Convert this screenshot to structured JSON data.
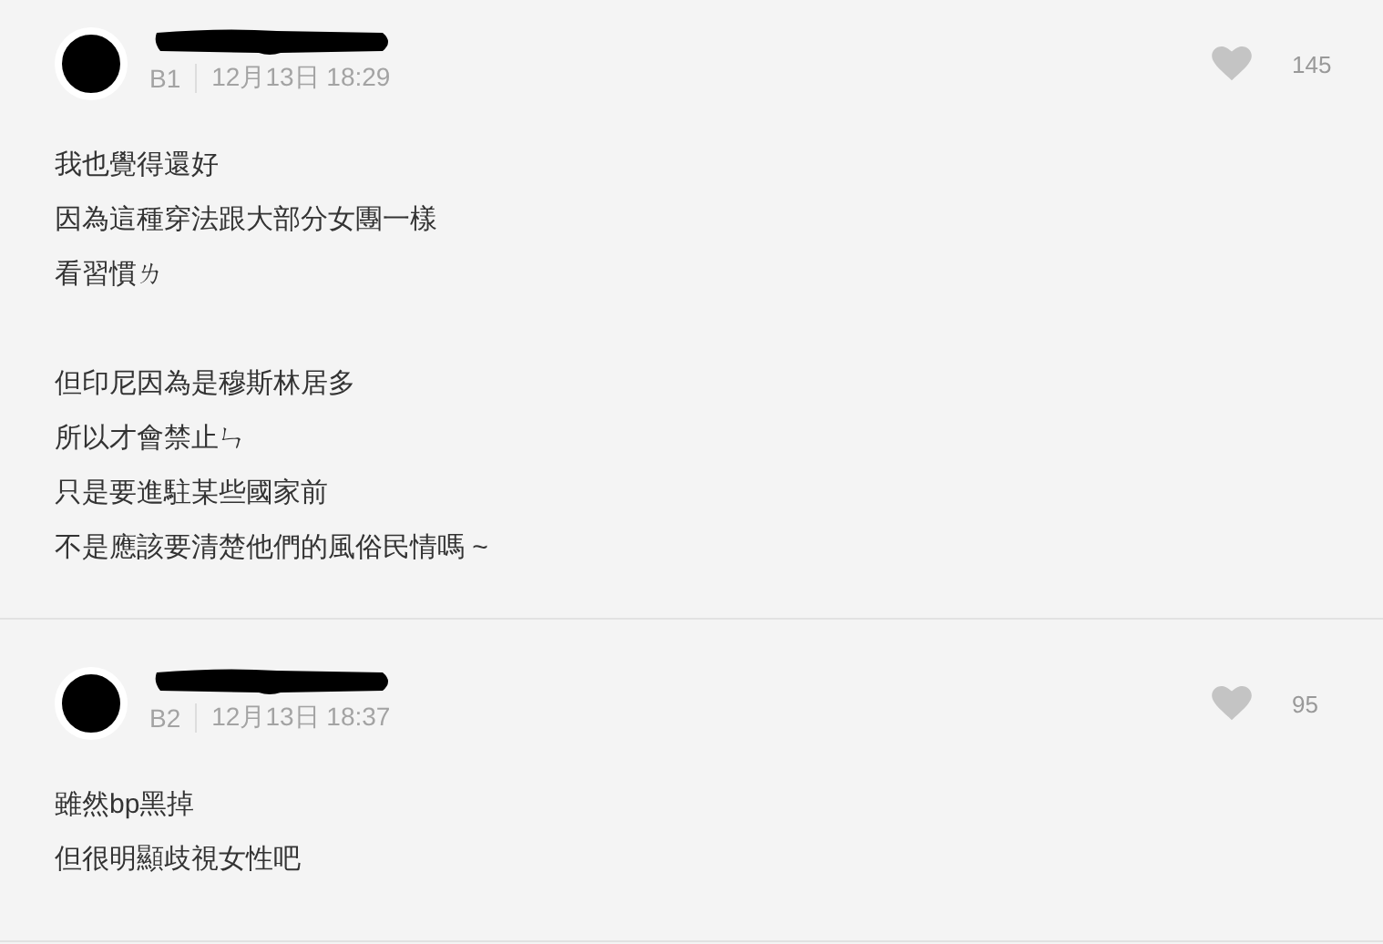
{
  "comments": [
    {
      "floor": "B1",
      "time": "12月13日 18:29",
      "likes": "145",
      "paragraphs": [
        [
          "我也覺得還好",
          "因為這種穿法跟大部分女團一樣",
          "看習慣ㄌ"
        ],
        [
          "但印尼因為是穆斯林居多",
          "所以才會禁止ㄣ",
          "只是要進駐某些國家前",
          "不是應該要清楚他們的風俗民情嗎 ~"
        ]
      ]
    },
    {
      "floor": "B2",
      "time": "12月13日 18:37",
      "likes": "95",
      "paragraphs": [
        [
          "雖然bp黑掉",
          "但很明顯歧視女性吧"
        ]
      ]
    }
  ]
}
